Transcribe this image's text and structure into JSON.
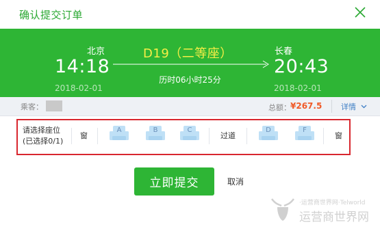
{
  "dialog": {
    "title": "确认提交订单"
  },
  "trip": {
    "from_station": "北京",
    "to_station": "长春",
    "depart_time": "14:18",
    "arrive_time": "20:43",
    "depart_date": "2018-02-01",
    "arrive_date": "2018-02-01",
    "train_number": "D19",
    "seat_class": "（二等座）",
    "duration": "历时06小时25分"
  },
  "summary": {
    "passenger_label": "乘客：",
    "total_label": "总额：",
    "total_amount": "¥267.5",
    "details_label": "详情"
  },
  "seat_selection": {
    "prompt_line1": "请选择座位",
    "prompt_line2": "(已选择0/1)",
    "window_left": "窗",
    "aisle": "过道",
    "window_right": "窗",
    "seats": [
      "A",
      "B",
      "C",
      "D",
      "F"
    ]
  },
  "actions": {
    "submit_label": "立即提交",
    "cancel_label": "取消"
  },
  "watermark": {
    "line1": "·运营商世界网·Telworld",
    "line2": "运营商世界网"
  },
  "colors": {
    "brand_green": "#2eb535",
    "title_green": "#2aa832",
    "train_yellow": "#f6ee46",
    "price_orange": "#f05a28",
    "highlight_red": "#d8262e",
    "link_blue": "#3f7fc5",
    "seat_blue": "#bfe0f6"
  },
  "icons": {
    "close": "close-icon",
    "chevron": "chevron-down-icon",
    "seat": "seat-icon",
    "arrow": "arrow-right-icon"
  }
}
